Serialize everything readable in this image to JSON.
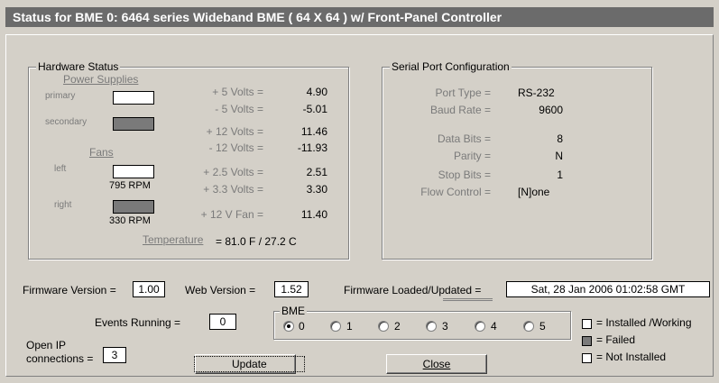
{
  "title": "Status for BME 0:   6464 series Wideband BME ( 64 X 64 )  w/ Front-Panel Controller",
  "hardware": {
    "legend": "Hardware Status",
    "power_supplies_label": "Power Supplies",
    "primary_label": "primary",
    "secondary_label": "secondary",
    "fans_label": "Fans",
    "left_label": "left",
    "right_label": "right",
    "left_rpm": "795 RPM",
    "right_rpm": "330 RPM",
    "volts": [
      {
        "label": "+ 5 Volts =",
        "value": "4.90"
      },
      {
        "label": "- 5 Volts =",
        "value": "-5.01"
      },
      {
        "label": "+ 12 Volts =",
        "value": "11.46"
      },
      {
        "label": "- 12 Volts =",
        "value": "-11.93"
      },
      {
        "label": "+ 2.5 Volts =",
        "value": "2.51"
      },
      {
        "label": "+ 3.3 Volts =",
        "value": "3.30"
      },
      {
        "label": "+ 12 V Fan =",
        "value": "11.40"
      }
    ],
    "temperature_label": "Temperature",
    "temperature_value": "= 81.0 F / 27.2 C",
    "status": {
      "primary": "installed",
      "secondary": "failed",
      "fan_left": "installed",
      "fan_right": "failed"
    }
  },
  "serial": {
    "legend": "Serial Port Configuration",
    "rows": [
      {
        "label": "Port Type =",
        "value": "RS-232"
      },
      {
        "label": "Baud Rate =",
        "value": "9600"
      },
      {
        "label": "Data Bits =",
        "value": "8"
      },
      {
        "label": "Parity =",
        "value": "N"
      },
      {
        "label": "Stop Bits =",
        "value": "1"
      },
      {
        "label": "Flow Control =",
        "value": "[N]one"
      }
    ]
  },
  "firmware_version_label": "Firmware Version =",
  "firmware_version": "1.00",
  "web_version_label": "Web Version =",
  "web_version": "1.52",
  "firmware_loaded_label": "Firmware Loaded/Updated =",
  "firmware_loaded": "Sat, 28 Jan 2006 01:02:58 GMT",
  "events_running_label": "Events Running =",
  "events_running": "0",
  "open_ip_label_1": "Open IP",
  "open_ip_label_2": "connections =",
  "open_ip": "3",
  "bme": {
    "legend": "BME",
    "options": [
      "0",
      "1",
      "2",
      "3",
      "4",
      "5"
    ],
    "selected": "0"
  },
  "update_button": "Update",
  "close_button": "Close",
  "status_legend": [
    {
      "label": "= Installed /Working",
      "color": "#ffffff"
    },
    {
      "label": "= Failed",
      "color": "#7a7a7a"
    },
    {
      "label": "= Not Installed",
      "color": "#ffffff"
    }
  ]
}
